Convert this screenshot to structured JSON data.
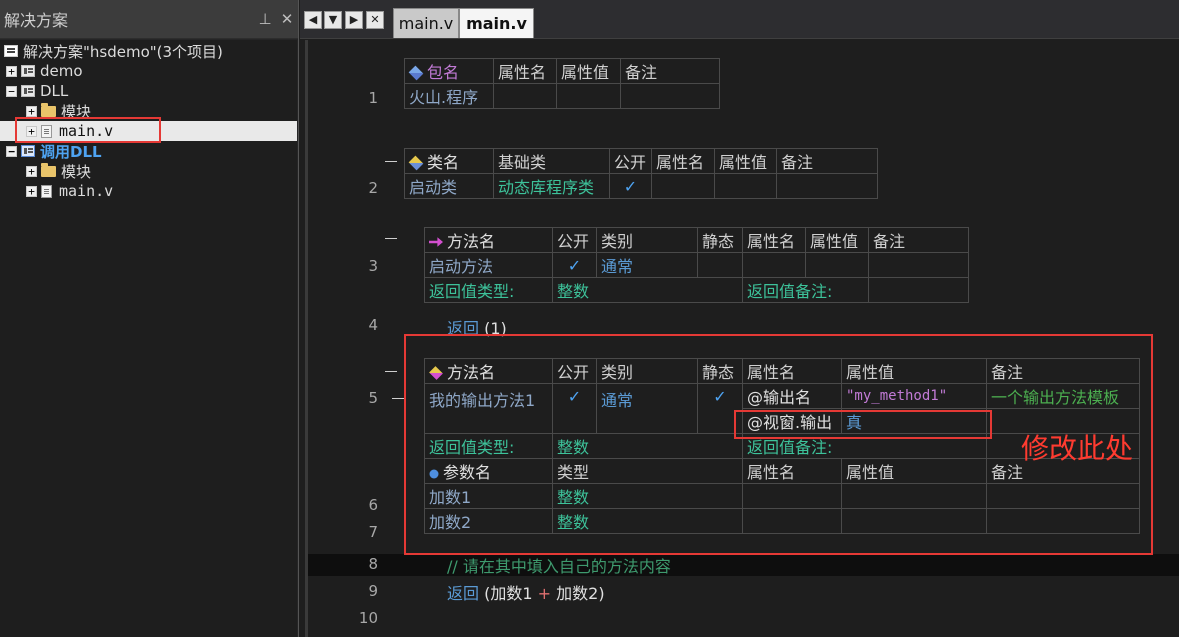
{
  "panel": {
    "title": "解决方案",
    "pin_icon": "pin-icon",
    "close_icon": "close-icon"
  },
  "tree": {
    "solution": "解决方案\"hsdemo\"(3个项目)",
    "demo": "demo",
    "dll": "DLL",
    "dll_module": "模块",
    "dll_main": "main.v",
    "call_dll": "调用DLL",
    "call_module": "模块",
    "call_main": "main.v"
  },
  "tabs": [
    {
      "label": "main.v",
      "active": false
    },
    {
      "label": "main.v",
      "active": true
    }
  ],
  "editor": {
    "line_numbers": [
      "1",
      "2",
      "3",
      "4",
      "5",
      "6",
      "7",
      "8",
      "9",
      "10"
    ],
    "pkg_table": {
      "headers": [
        "包名",
        "属性名",
        "属性值",
        "备注"
      ],
      "row": [
        "火山.程序",
        "",
        "",
        ""
      ]
    },
    "class_table": {
      "headers": [
        "类名",
        "基础类",
        "公开",
        "属性名",
        "属性值",
        "备注"
      ],
      "row": [
        "启动类",
        "动态库程序类",
        "✓",
        "",
        "",
        ""
      ]
    },
    "method1": {
      "headers": [
        "方法名",
        "公开",
        "类别",
        "静态",
        "属性名",
        "属性值",
        "备注"
      ],
      "row": [
        "启动方法",
        "✓",
        "通常",
        "",
        "",
        "",
        ""
      ],
      "ret_type_label": "返回值类型:",
      "ret_type": "整数",
      "ret_note_label": "返回值备注:"
    },
    "line4": {
      "kw": "返回",
      "rest": "(1)"
    },
    "method2": {
      "headers": [
        "方法名",
        "公开",
        "类别",
        "静态",
        "属性名",
        "属性值",
        "备注"
      ],
      "row": [
        "我的输出方法1",
        "✓",
        "通常",
        "✓",
        "@输出名",
        "\"my_method1\"",
        "一个输出方法模板"
      ],
      "row2_attr": "@视窗.输出",
      "row2_val": "真",
      "ret_type_label": "返回值类型:",
      "ret_type": "整数",
      "ret_note_label": "返回值备注:",
      "param_headers": [
        "参数名",
        "类型",
        "属性名",
        "属性值",
        "备注"
      ],
      "params": [
        {
          "name": "加数1",
          "type": "整数"
        },
        {
          "name": "加数2",
          "type": "整数"
        }
      ]
    },
    "line8": "// 请在其中填入自己的方法内容",
    "line9": {
      "kw": "返回",
      "open": "(加数1",
      "op": "+",
      "close": "加数2)"
    }
  },
  "annotation": "修改此处",
  "colors": {
    "annotation": "#e53935"
  }
}
